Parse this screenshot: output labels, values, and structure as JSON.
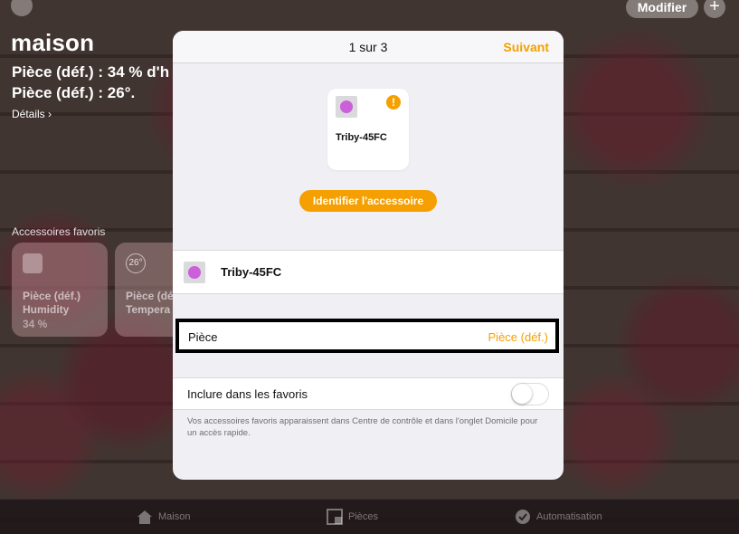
{
  "background": {
    "home_title": "maison",
    "status_line_1": "Pièce (déf.) : 34 % d'h",
    "status_line_2": "Pièce (déf.) : 26°.",
    "details_link": "Détails ›",
    "modify_button": "Modifier",
    "add_button": "+",
    "favorites_label": "Accessoires favoris",
    "tiles": [
      {
        "icon": "humidity-sensor-icon",
        "badge": "",
        "room": "Pièce (déf.)",
        "name": "Humidity",
        "value": "34 %"
      },
      {
        "icon": "thermometer-icon",
        "badge": "26°",
        "room": "Pièce (déf",
        "name": "Tempera",
        "value": ""
      }
    ],
    "tabbar": [
      {
        "icon": "house-icon",
        "label": "Maison"
      },
      {
        "icon": "rooms-icon",
        "label": "Pièces"
      },
      {
        "icon": "automation-icon",
        "label": "Automatisation"
      }
    ]
  },
  "modal": {
    "title": "1 sur 3",
    "next_button": "Suivant",
    "accessory_card_name": "Triby-45FC",
    "identify_button": "Identifier l'accessoire",
    "accessory_name": "Triby-45FC",
    "room_row": {
      "label": "Pièce",
      "value": "Pièce (déf.)"
    },
    "favorites_row": {
      "label": "Inclure dans les favoris",
      "enabled": false
    },
    "favorites_footnote": "Vos accessoires favoris apparaissent dans Centre de contrôle et dans l'onglet Domicile pour un accès rapide."
  },
  "colors": {
    "accent": "#f5a000",
    "accessory_dot": "#cc60d8",
    "modal_bg": "#efeff4"
  }
}
